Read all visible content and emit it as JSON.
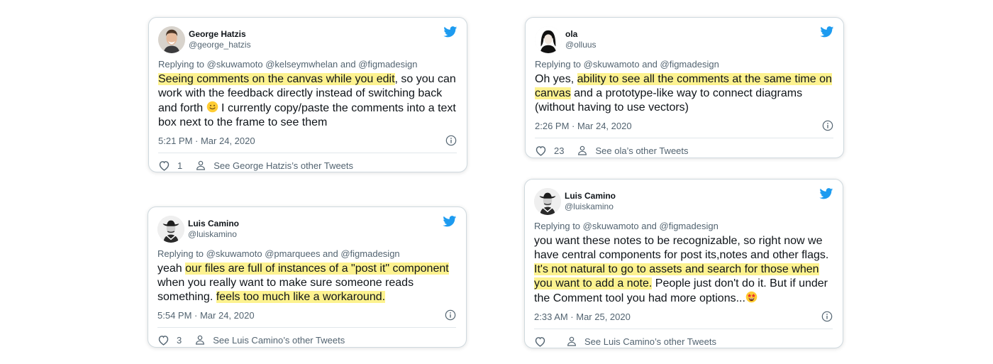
{
  "colors": {
    "highlight": "#fdf28f",
    "twitter_blue": "#1d9bf0",
    "muted": "#536471"
  },
  "tweets": [
    {
      "name": "George Hatzis",
      "handle": "@george_hatzis",
      "replying": "Replying to @skuwamoto @kelseymwhelan and @figmadesign",
      "hl1": "Seeing comments on the canvas while you edit",
      "text1": ", so you can work with the feedback directly instead of switching back and forth ",
      "emoji": "slightly-smiling-face",
      "text2": " I currently copy/paste the comments into a text box next to the frame to see them",
      "timestamp": "5:21 PM · Mar 24, 2020",
      "likes": "1",
      "see_more": "See George Hatzis’s other Tweets"
    },
    {
      "name": "ola",
      "handle": "@olluus",
      "replying": "Replying to @skuwamoto and @figmadesign",
      "text0": "Oh yes, ",
      "hl1": "ability to see all the comments at the same time on canvas",
      "text1": " and a prototype-like way to connect diagrams (without having to use vectors)",
      "timestamp": "2:26 PM · Mar 24, 2020",
      "likes": "23",
      "see_more": "See ola’s other Tweets"
    },
    {
      "name": "Luis Camino",
      "handle": "@luiskamino",
      "replying": "Replying to @skuwamoto @pmarquees and @figmadesign",
      "text0": "yeah ",
      "hl1": "our files are full of instances of a \"post it\" component",
      "text1": " when you really want to make sure someone reads something. ",
      "hl2": "feels too much like a workaround.",
      "timestamp": "5:54 PM · Mar 24, 2020",
      "likes": "3",
      "see_more": "See Luis Camino’s other Tweets"
    },
    {
      "name": "Luis Camino",
      "handle": "@luiskamino",
      "replying": "Replying to @skuwamoto and @figmadesign",
      "text0": "you want these notes to be recognizable, so right now we have central components for post its,notes and other flags. ",
      "hl1": "It's not natural to go to assets and search for those when you want to add a note.",
      "text1": " People just don't do it. But if under the Comment tool you had more options...",
      "emoji": "star-struck",
      "timestamp": "2:33 AM · Mar 25, 2020",
      "likes": "",
      "see_more": "See Luis Camino’s other Tweets"
    }
  ]
}
